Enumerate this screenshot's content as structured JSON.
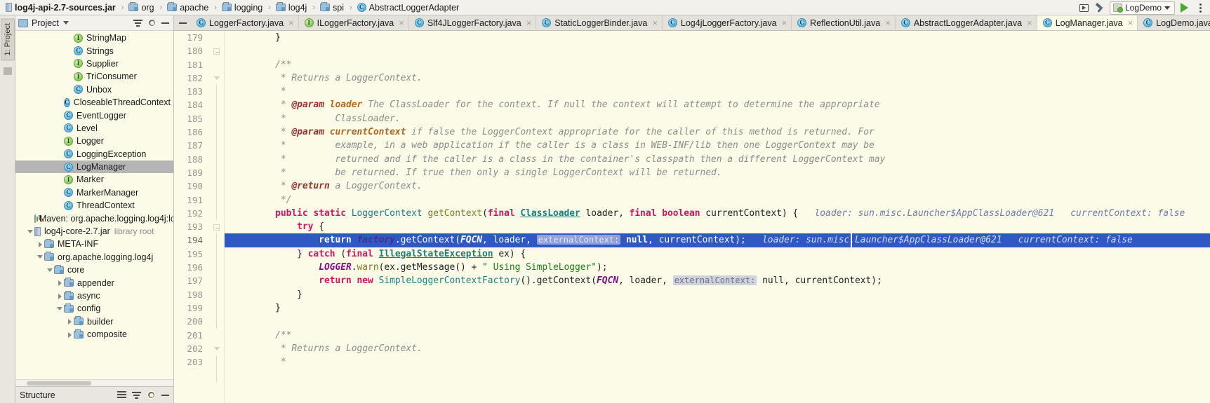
{
  "breadcrumb": {
    "items": [
      {
        "label": "log4j-api-2.7-sources.jar",
        "icon": "jar-icon",
        "root": true
      },
      {
        "label": "org",
        "icon": "folder-icon"
      },
      {
        "label": "apache",
        "icon": "folder-icon"
      },
      {
        "label": "logging",
        "icon": "folder-icon"
      },
      {
        "label": "log4j",
        "icon": "folder-icon"
      },
      {
        "label": "spi",
        "icon": "folder-icon"
      },
      {
        "label": "AbstractLoggerAdapter",
        "icon": "class-icon"
      }
    ],
    "separator": "›"
  },
  "toolbar": {
    "preview_icon": "preview-icon",
    "build_icon": "hammer-icon",
    "run_config": "LogDemo",
    "run_icon": "run-icon",
    "more_icon": "more-icon"
  },
  "left_strip": {
    "project_tab": "1: Project",
    "structure_icon": "structure-icon"
  },
  "project_panel": {
    "title": "Project",
    "collapse_icon": "collapse-all-icon",
    "gear_icon": "gear-icon",
    "minimize_icon": "minimize-icon",
    "tree": [
      {
        "label": "StringMap",
        "icon": "interface-icon",
        "indent": 5,
        "arrow": "none"
      },
      {
        "label": "Strings",
        "icon": "class-icon",
        "indent": 5,
        "arrow": "none"
      },
      {
        "label": "Supplier",
        "icon": "interface-icon",
        "indent": 5,
        "arrow": "none"
      },
      {
        "label": "TriConsumer",
        "icon": "interface-icon",
        "indent": 5,
        "arrow": "none"
      },
      {
        "label": "Unbox",
        "icon": "class-icon",
        "indent": 5,
        "arrow": "none"
      },
      {
        "label": "CloseableThreadContext",
        "icon": "class-icon",
        "indent": 4,
        "arrow": "none"
      },
      {
        "label": "EventLogger",
        "icon": "class-icon",
        "indent": 4,
        "arrow": "none"
      },
      {
        "label": "Level",
        "icon": "class-icon",
        "indent": 4,
        "arrow": "none"
      },
      {
        "label": "Logger",
        "icon": "interface-icon",
        "indent": 4,
        "arrow": "none"
      },
      {
        "label": "LoggingException",
        "icon": "class-icon",
        "indent": 4,
        "arrow": "none"
      },
      {
        "label": "LogManager",
        "icon": "class-icon",
        "indent": 4,
        "arrow": "none",
        "selected": true
      },
      {
        "label": "Marker",
        "icon": "interface-icon",
        "indent": 4,
        "arrow": "none"
      },
      {
        "label": "MarkerManager",
        "icon": "class-icon",
        "indent": 4,
        "arrow": "none"
      },
      {
        "label": "ThreadContext",
        "icon": "class-icon",
        "indent": 4,
        "arrow": "none"
      },
      {
        "label": "Maven: org.apache.logging.log4j:lo",
        "icon": "maven-icon",
        "indent": 1,
        "arrow": "none"
      },
      {
        "label": "log4j-core-2.7.jar",
        "sub": "library root",
        "icon": "jar-icon",
        "indent": 1,
        "arrow": "open"
      },
      {
        "label": "META-INF",
        "icon": "folder-icon",
        "indent": 2,
        "arrow": "closed"
      },
      {
        "label": "org.apache.logging.log4j",
        "icon": "folder-icon",
        "indent": 2,
        "arrow": "open"
      },
      {
        "label": "core",
        "icon": "folder-icon",
        "indent": 3,
        "arrow": "open"
      },
      {
        "label": "appender",
        "icon": "folder-icon",
        "indent": 4,
        "arrow": "closed"
      },
      {
        "label": "async",
        "icon": "folder-icon",
        "indent": 4,
        "arrow": "closed"
      },
      {
        "label": "config",
        "icon": "folder-icon",
        "indent": 4,
        "arrow": "open"
      },
      {
        "label": "builder",
        "icon": "folder-icon",
        "indent": 5,
        "arrow": "closed"
      },
      {
        "label": "composite",
        "icon": "folder-icon",
        "indent": 5,
        "arrow": "closed"
      }
    ]
  },
  "structure_panel": {
    "title": "Structure",
    "expand_icon": "expand-all-icon",
    "collapse_icon": "collapse-all-icon",
    "gear_icon": "gear-icon",
    "minimize_icon": "minimize-icon"
  },
  "editor_tabs": {
    "minimize_icon": "minimize-icon",
    "close_glyph": "×",
    "items": [
      {
        "label": "LoggerFactory.java",
        "icon": "class-icon",
        "active": false
      },
      {
        "label": "ILoggerFactory.java",
        "icon": "interface-icon",
        "active": false
      },
      {
        "label": "Slf4JLoggerFactory.java",
        "icon": "class-icon",
        "active": false
      },
      {
        "label": "StaticLoggerBinder.java",
        "icon": "class-icon",
        "active": false
      },
      {
        "label": "Log4jLoggerFactory.java",
        "icon": "class-icon",
        "active": false
      },
      {
        "label": "ReflectionUtil.java",
        "icon": "class-icon",
        "active": false
      },
      {
        "label": "AbstractLoggerAdapter.java",
        "icon": "class-icon",
        "active": false
      },
      {
        "label": "LogManager.java",
        "icon": "class-icon",
        "active": true
      },
      {
        "label": "LogDemo.java",
        "icon": "class-icon",
        "active": false
      }
    ]
  },
  "editor": {
    "first_line_number": 179,
    "highlighted_line": 194,
    "line_numbers": [
      179,
      180,
      181,
      182,
      183,
      184,
      185,
      186,
      187,
      188,
      189,
      190,
      191,
      192,
      193,
      194,
      195,
      196,
      197,
      198,
      199,
      200,
      201,
      202,
      203
    ],
    "lines": [
      {
        "n": 179,
        "indent": 8,
        "tokens": [
          {
            "t": "}",
            "c": "ident"
          }
        ]
      },
      {
        "n": 180,
        "indent": 0,
        "tokens": []
      },
      {
        "n": 181,
        "indent": 8,
        "tokens": [
          {
            "t": "/**",
            "c": "cmt"
          }
        ]
      },
      {
        "n": 182,
        "indent": 9,
        "tokens": [
          {
            "t": "* Returns a LoggerContext.",
            "c": "cmt"
          }
        ]
      },
      {
        "n": 183,
        "indent": 9,
        "tokens": [
          {
            "t": "*",
            "c": "cmt"
          }
        ]
      },
      {
        "n": 184,
        "indent": 9,
        "tokens": [
          {
            "t": "* ",
            "c": "cmt"
          },
          {
            "t": "@param",
            "c": "cmt-tag"
          },
          {
            "t": " ",
            "c": "cmt"
          },
          {
            "t": "loader",
            "c": "cmt-param"
          },
          {
            "t": " The ClassLoader for the context. If null the context will attempt to determine the appropriate",
            "c": "cmt"
          }
        ]
      },
      {
        "n": 185,
        "indent": 9,
        "tokens": [
          {
            "t": "*         ClassLoader.",
            "c": "cmt"
          }
        ]
      },
      {
        "n": 186,
        "indent": 9,
        "tokens": [
          {
            "t": "* ",
            "c": "cmt"
          },
          {
            "t": "@param",
            "c": "cmt-tag"
          },
          {
            "t": " ",
            "c": "cmt"
          },
          {
            "t": "currentContext",
            "c": "cmt-param"
          },
          {
            "t": " if false the LoggerContext appropriate for the caller of this method is returned. For",
            "c": "cmt"
          }
        ]
      },
      {
        "n": 187,
        "indent": 9,
        "tokens": [
          {
            "t": "*         example, in a web application if the caller is a class in WEB-INF/lib then one LoggerContext may be",
            "c": "cmt"
          }
        ]
      },
      {
        "n": 188,
        "indent": 9,
        "tokens": [
          {
            "t": "*         returned and if the caller is a class in the container's classpath then a different LoggerContext may",
            "c": "cmt"
          }
        ]
      },
      {
        "n": 189,
        "indent": 9,
        "tokens": [
          {
            "t": "*         be returned. If true then only a single LoggerContext will be returned.",
            "c": "cmt"
          }
        ]
      },
      {
        "n": 190,
        "indent": 9,
        "tokens": [
          {
            "t": "* ",
            "c": "cmt"
          },
          {
            "t": "@return",
            "c": "cmt-tag"
          },
          {
            "t": " a LoggerContext.",
            "c": "cmt"
          }
        ]
      },
      {
        "n": 191,
        "indent": 9,
        "tokens": [
          {
            "t": "*/",
            "c": "cmt"
          }
        ]
      },
      {
        "n": 192,
        "indent": 8,
        "tokens": [
          {
            "t": "public",
            "c": "kw"
          },
          {
            "t": " ",
            "c": "ident"
          },
          {
            "t": "static",
            "c": "kw"
          },
          {
            "t": " ",
            "c": "ident"
          },
          {
            "t": "LoggerContext",
            "c": "cls"
          },
          {
            "t": " ",
            "c": "ident"
          },
          {
            "t": "getContext",
            "c": "kw2"
          },
          {
            "t": "(",
            "c": "ident"
          },
          {
            "t": "final",
            "c": "kw"
          },
          {
            "t": " ",
            "c": "ident"
          },
          {
            "t": "ClassLoader",
            "c": "cls-u"
          },
          {
            "t": " loader, ",
            "c": "ident"
          },
          {
            "t": "final",
            "c": "kw"
          },
          {
            "t": " ",
            "c": "ident"
          },
          {
            "t": "boolean",
            "c": "kw"
          },
          {
            "t": " currentContext) {",
            "c": "ident"
          },
          {
            "t": "   loader: sun.misc.Launcher$AppClassLoader@621   currentContext: false",
            "c": "hint-dbg"
          }
        ]
      },
      {
        "n": 193,
        "indent": 12,
        "tokens": [
          {
            "t": "try",
            "c": "kw"
          },
          {
            "t": " {",
            "c": "ident"
          }
        ]
      },
      {
        "n": 194,
        "indent": 16,
        "highlight": true,
        "tokens": [
          {
            "t": "return",
            "c": "kw"
          },
          {
            "t": " ",
            "c": "ident"
          },
          {
            "t": "factory",
            "c": "stat"
          },
          {
            "t": ".getContext(",
            "c": "ident"
          },
          {
            "t": "FQCN",
            "c": "fld"
          },
          {
            "t": ", loader, ",
            "c": "ident"
          },
          {
            "t": "externalContext:",
            "c": "hint-chip"
          },
          {
            "t": " ",
            "c": "ident"
          },
          {
            "t": "null",
            "c": "kw"
          },
          {
            "t": ", currentContext);",
            "c": "ident"
          },
          {
            "t": "   loader: sun.misc.Launcher$AppClassLoader@621   currentContext: false",
            "c": "hint-dbg"
          }
        ]
      },
      {
        "n": 195,
        "indent": 12,
        "tokens": [
          {
            "t": "} ",
            "c": "ident"
          },
          {
            "t": "catch",
            "c": "kw"
          },
          {
            "t": " (",
            "c": "ident"
          },
          {
            "t": "final",
            "c": "kw"
          },
          {
            "t": " ",
            "c": "ident"
          },
          {
            "t": "IllegalStateException",
            "c": "cls-u"
          },
          {
            "t": " ex) {",
            "c": "ident"
          }
        ]
      },
      {
        "n": 196,
        "indent": 16,
        "tokens": [
          {
            "t": "LOGGER",
            "c": "fld"
          },
          {
            "t": ".",
            "c": "ident"
          },
          {
            "t": "warn",
            "c": "kw2"
          },
          {
            "t": "(ex.getMessage() + ",
            "c": "ident"
          },
          {
            "t": "\" Using SimpleLogger\"",
            "c": "str"
          },
          {
            "t": ");",
            "c": "ident"
          }
        ]
      },
      {
        "n": 197,
        "indent": 16,
        "tokens": [
          {
            "t": "return",
            "c": "kw"
          },
          {
            "t": " ",
            "c": "ident"
          },
          {
            "t": "new",
            "c": "kw"
          },
          {
            "t": " ",
            "c": "ident"
          },
          {
            "t": "SimpleLoggerContextFactory",
            "c": "cls"
          },
          {
            "t": "().getContext(",
            "c": "ident"
          },
          {
            "t": "FQCN",
            "c": "fld"
          },
          {
            "t": ", loader, ",
            "c": "ident"
          },
          {
            "t": "externalContext:",
            "c": "hint-chip"
          },
          {
            "t": " ",
            "c": "ident"
          },
          {
            "t": "null",
            "c": "ident"
          },
          {
            "t": ", currentContext);",
            "c": "ident"
          }
        ]
      },
      {
        "n": 198,
        "indent": 12,
        "tokens": [
          {
            "t": "}",
            "c": "ident"
          }
        ]
      },
      {
        "n": 199,
        "indent": 8,
        "tokens": [
          {
            "t": "}",
            "c": "ident"
          }
        ]
      },
      {
        "n": 200,
        "indent": 0,
        "tokens": []
      },
      {
        "n": 201,
        "indent": 8,
        "tokens": [
          {
            "t": "/**",
            "c": "cmt"
          }
        ]
      },
      {
        "n": 202,
        "indent": 9,
        "tokens": [
          {
            "t": "* Returns a LoggerContext.",
            "c": "cmt"
          }
        ]
      },
      {
        "n": 203,
        "indent": 9,
        "tokens": [
          {
            "t": "*",
            "c": "cmt"
          }
        ]
      }
    ]
  },
  "colors": {
    "selection_blue": "#2f58c4",
    "editor_bg": "#fbfbe8",
    "panel_bg": "#e8e6df",
    "keyword": "#d8115e",
    "comment": "#8c8c8c",
    "string": "#1a8016"
  }
}
